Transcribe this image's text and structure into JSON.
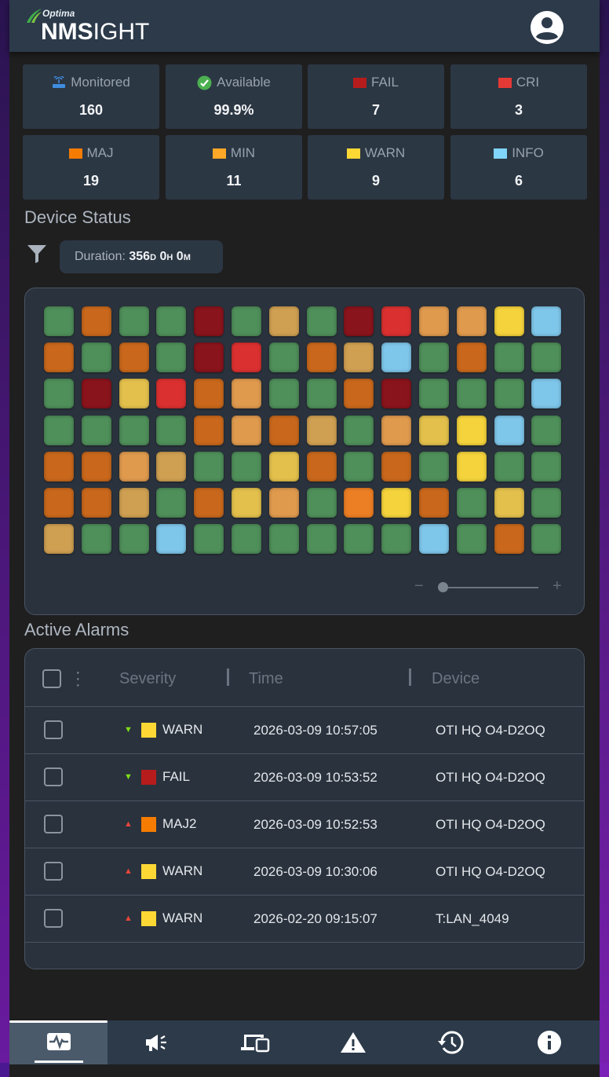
{
  "header": {
    "brand_small": "Optima",
    "brand_bold": "NMS",
    "brand_light": "IGHT",
    "avatar_icon": "account-circle-icon"
  },
  "stats": [
    {
      "label": "Monitored",
      "value": "160",
      "icon": "router-icon",
      "color": "#3f8de0"
    },
    {
      "label": "Available",
      "value": "99.9%",
      "icon": "check-circle-icon",
      "color": "#4caf50"
    },
    {
      "label": "FAIL",
      "value": "7",
      "icon": "square",
      "color": "#b71c1c"
    },
    {
      "label": "CRI",
      "value": "3",
      "icon": "square",
      "color": "#e53935"
    },
    {
      "label": "MAJ",
      "value": "19",
      "icon": "square",
      "color": "#f57c00"
    },
    {
      "label": "MIN",
      "value": "11",
      "icon": "square",
      "color": "#ffa726"
    },
    {
      "label": "WARN",
      "value": "9",
      "icon": "square",
      "color": "#fdd835"
    },
    {
      "label": "INFO",
      "value": "6",
      "icon": "square",
      "color": "#81d4fa"
    }
  ],
  "device_status": {
    "title": "Device Status",
    "duration_label": "Duration:",
    "duration_days": "356",
    "duration_d": "D",
    "duration_hours": "0",
    "duration_h": "H",
    "duration_minutes": "0",
    "duration_m": "M",
    "zoom_minus": "−",
    "zoom_plus": "+",
    "status_colors": {
      "G": "#4f8f5a",
      "O": "#c9681c",
      "o": "#df9a4e",
      "T": "#cfa052",
      "R": "#8a141c",
      "r": "#db3030",
      "Y": "#f4d33c",
      "y": "#e3c04c",
      "B": "#7ec6ea",
      "F": "#ec7e24"
    },
    "grid": [
      [
        "G",
        "O",
        "G",
        "G",
        "R",
        "G",
        "T",
        "G",
        "R",
        "r",
        "o",
        "o",
        "Y",
        "B"
      ],
      [
        "O",
        "G",
        "O",
        "G",
        "R",
        "r",
        "G",
        "O",
        "T",
        "B",
        "G",
        "O",
        "G",
        "G"
      ],
      [
        "G",
        "R",
        "y",
        "r",
        "O",
        "o",
        "G",
        "G",
        "O",
        "R",
        "G",
        "G",
        "G",
        "B"
      ],
      [
        "G",
        "G",
        "G",
        "G",
        "O",
        "o",
        "O",
        "T",
        "G",
        "o",
        "y",
        "Y",
        "B",
        "G"
      ],
      [
        "O",
        "O",
        "o",
        "T",
        "G",
        "G",
        "y",
        "O",
        "G",
        "O",
        "G",
        "Y",
        "G",
        "G"
      ],
      [
        "O",
        "O",
        "T",
        "G",
        "O",
        "y",
        "o",
        "G",
        "F",
        "Y",
        "O",
        "G",
        "y",
        "G"
      ],
      [
        "T",
        "G",
        "G",
        "B",
        "G",
        "G",
        "G",
        "G",
        "G",
        "G",
        "B",
        "G",
        "O",
        "G"
      ]
    ]
  },
  "alarms": {
    "title": "Active Alarms",
    "columns": [
      "Severity",
      "Time",
      "Device"
    ],
    "rows": [
      {
        "trend": "down",
        "color": "#fdd835",
        "severity": "WARN",
        "time": "2026-03-09 10:57:05",
        "device": "OTI HQ O4-D2OQ"
      },
      {
        "trend": "down",
        "color": "#b71c1c",
        "severity": "FAIL",
        "time": "2026-03-09 10:53:52",
        "device": "OTI HQ O4-D2OQ"
      },
      {
        "trend": "up",
        "color": "#f57c00",
        "severity": "MAJ2",
        "time": "2026-03-09 10:52:53",
        "device": "OTI HQ O4-D2OQ"
      },
      {
        "trend": "up",
        "color": "#fdd835",
        "severity": "WARN",
        "time": "2026-03-09 10:30:06",
        "device": "OTI HQ O4-D2OQ"
      },
      {
        "trend": "up",
        "color": "#fdd835",
        "severity": "WARN",
        "time": "2026-02-20 09:15:07",
        "device": "T:LAN_4049"
      }
    ]
  },
  "nav": [
    {
      "name": "dashboard-icon",
      "active": true
    },
    {
      "name": "announcement-icon",
      "active": false
    },
    {
      "name": "devices-icon",
      "active": false
    },
    {
      "name": "warning-icon",
      "active": false
    },
    {
      "name": "history-icon",
      "active": false
    },
    {
      "name": "info-icon",
      "active": false
    }
  ]
}
